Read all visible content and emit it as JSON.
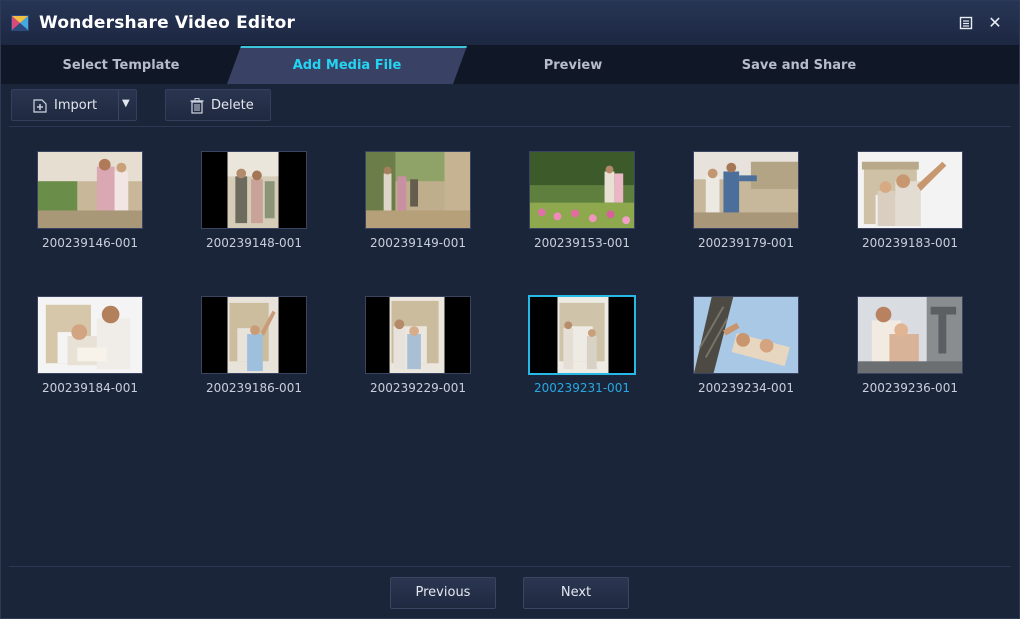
{
  "window": {
    "title": "Wondershare Video Editor",
    "restore_icon": "restore-icon",
    "close_icon": "close-icon"
  },
  "tabs": [
    {
      "label": "Select Template",
      "active": false
    },
    {
      "label": "Add Media File",
      "active": true
    },
    {
      "label": "Preview",
      "active": false
    },
    {
      "label": "Save and Share",
      "active": false
    }
  ],
  "toolbar": {
    "import_label": "Import",
    "delete_label": "Delete",
    "import_icon": "add-file-icon",
    "dropdown_icon": "dropdown-arrow-icon",
    "delete_icon": "trash-icon"
  },
  "media": [
    {
      "name": "200239146-001",
      "selected": false
    },
    {
      "name": "200239148-001",
      "selected": false
    },
    {
      "name": "200239149-001",
      "selected": false
    },
    {
      "name": "200239153-001",
      "selected": false
    },
    {
      "name": "200239179-001",
      "selected": false
    },
    {
      "name": "200239183-001",
      "selected": false
    },
    {
      "name": "200239184-001",
      "selected": false
    },
    {
      "name": "200239186-001",
      "selected": false
    },
    {
      "name": "200239229-001",
      "selected": false
    },
    {
      "name": "200239231-001",
      "selected": true
    },
    {
      "name": "200239234-001",
      "selected": false
    },
    {
      "name": "200239236-001",
      "selected": false
    }
  ],
  "footer": {
    "previous_label": "Previous",
    "next_label": "Next"
  },
  "colors": {
    "accent": "#25d4f2",
    "selected_caption": "#27a8e3",
    "background": "#1b253a"
  }
}
